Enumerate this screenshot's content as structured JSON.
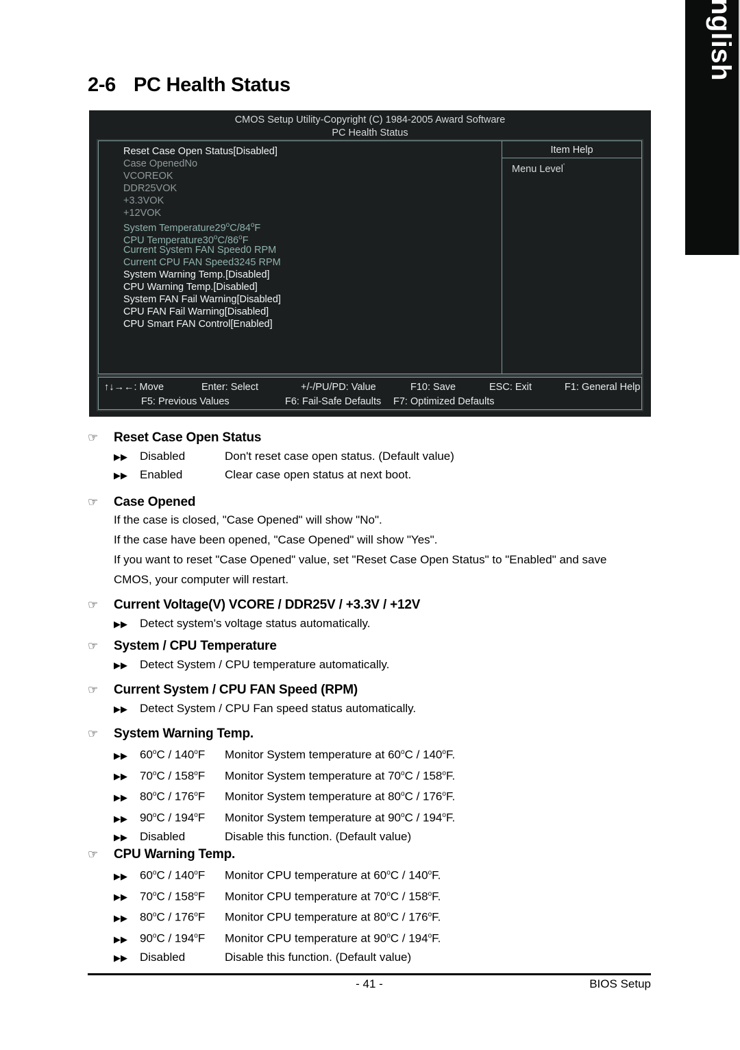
{
  "language_tab": {
    "label": "English"
  },
  "page_heading": {
    "number": "2-6",
    "title": "PC Health Status"
  },
  "bios": {
    "title_line1": "CMOS Setup Utility-Copyright (C) 1984-2005 Award Software",
    "title_line2": "PC Health Status",
    "item_help": {
      "header": "Item Help",
      "menu_level": "Menu Level",
      "menu_level_sup": "‘"
    },
    "rows": [
      {
        "label": "Reset Case Open Status",
        "value": "[Disabled]",
        "style": "white"
      },
      {
        "label": "Case Opened",
        "value": "No",
        "style": "gray"
      },
      {
        "label": "VCORE",
        "value": "OK",
        "style": "gray"
      },
      {
        "label": "DDR25V",
        "value": "OK",
        "style": "gray"
      },
      {
        "label": "+3.3V",
        "value": "OK",
        "style": "gray"
      },
      {
        "label": "+12V",
        "value": "OK",
        "style": "gray"
      },
      {
        "label": "System Temperature",
        "value": "29°C/84°F",
        "style": "teal"
      },
      {
        "label": "CPU Temperature",
        "value": "30°C/86°F",
        "style": "teal"
      },
      {
        "label": "Current System FAN Speed",
        "value": "0     RPM",
        "style": "teal"
      },
      {
        "label": "Current CPU FAN Speed",
        "value": "3245 RPM",
        "style": "teal"
      },
      {
        "label": "System Warning Temp.",
        "value": "[Disabled]",
        "style": "white"
      },
      {
        "label": "CPU Warning Temp.",
        "value": "[Disabled]",
        "style": "white"
      },
      {
        "label": "System FAN Fail Warning",
        "value": "[Disabled]",
        "style": "white"
      },
      {
        "label": "CPU FAN Fail Warning",
        "value": "[Disabled]",
        "style": "white"
      },
      {
        "label": "CPU Smart FAN Control",
        "value": "[Enabled]",
        "style": "white"
      }
    ],
    "keys_row1": [
      "↑↓→←: Move",
      "Enter: Select",
      "+/-/PU/PD: Value",
      "F10: Save",
      "ESC: Exit",
      "F1: General Help"
    ],
    "keys_row2": [
      "F5: Previous Values",
      "F6: Fail-Safe Defaults",
      "F7: Optimized Defaults"
    ]
  },
  "icons": {
    "hand": "☞",
    "bullet": "▶▶"
  },
  "sections": [
    {
      "heading": "Reset Case Open Status",
      "options": [
        {
          "name": "Disabled",
          "desc": "Don't reset case open status. (Default value)"
        },
        {
          "name": "Enabled",
          "desc": "Clear case open status at next boot."
        }
      ]
    },
    {
      "heading": "Case Opened",
      "paragraphs": [
        "If the case is closed, \"Case Opened\" will show \"No\".",
        "If the case have been opened, \"Case Opened\" will show \"Yes\".",
        "If you want to reset \"Case Opened\" value, set \"Reset Case Open Status\" to \"Enabled\" and save",
        "CMOS, your computer will restart."
      ]
    },
    {
      "heading": "Current Voltage(V) VCORE / DDR25V / +3.3V / +12V",
      "lines": [
        "Detect system's voltage status automatically."
      ]
    },
    {
      "heading": "System / CPU Temperature",
      "lines": [
        "Detect System / CPU temperature automatically."
      ]
    },
    {
      "heading": "Current System / CPU FAN Speed (RPM)",
      "lines": [
        "Detect System / CPU Fan speed status automatically."
      ]
    },
    {
      "heading": "System Warning Temp.",
      "options": [
        {
          "name": "60°C / 140°F",
          "desc": "Monitor System temperature at 60°C / 140°F."
        },
        {
          "name": "70°C / 158°F",
          "desc": "Monitor System temperature at 70°C / 158°F."
        },
        {
          "name": "80°C / 176°F",
          "desc": "Monitor System temperature at 80°C / 176°F."
        },
        {
          "name": "90°C / 194°F",
          "desc": "Monitor System temperature at 90°C / 194°F."
        },
        {
          "name": "Disabled",
          "desc": "Disable this function. (Default value)"
        }
      ]
    },
    {
      "heading": "CPU Warning Temp.",
      "options": [
        {
          "name": "60°C / 140°F",
          "desc": "Monitor CPU temperature at 60°C / 140°F."
        },
        {
          "name": "70°C / 158°F",
          "desc": "Monitor CPU temperature at 70°C / 158°F."
        },
        {
          "name": "80°C / 176°F",
          "desc": "Monitor CPU temperature at 80°C / 176°F."
        },
        {
          "name": "90°C / 194°F",
          "desc": "Monitor CPU temperature at 90°C / 194°F."
        },
        {
          "name": "Disabled",
          "desc": "Disable this function. (Default value)"
        }
      ]
    }
  ],
  "footer": {
    "page_number": "- 41 -",
    "right_label": "BIOS Setup"
  }
}
